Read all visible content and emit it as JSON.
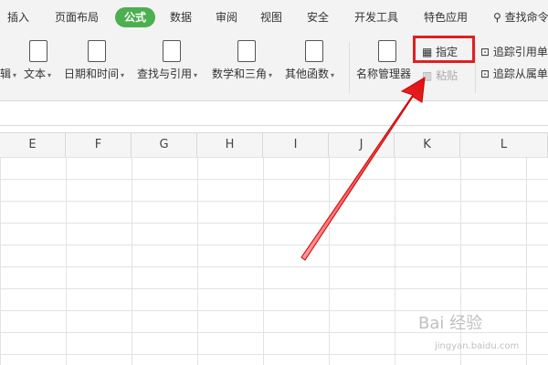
{
  "tabs": [
    {
      "label": "插入"
    },
    {
      "label": "页面布局"
    },
    {
      "label": "公式"
    },
    {
      "label": "数据"
    },
    {
      "label": "审阅"
    },
    {
      "label": "视图"
    },
    {
      "label": "安全"
    },
    {
      "label": "开发工具"
    },
    {
      "label": "特色应用"
    }
  ],
  "search": {
    "icon": "search-icon",
    "label": "查找命令"
  },
  "ribbon": {
    "groups": [
      {
        "label": "辑"
      },
      {
        "label": "文本"
      },
      {
        "label": "日期和时间"
      },
      {
        "label": "查找与引用"
      },
      {
        "label": "数学和三角"
      },
      {
        "label": "其他函数"
      }
    ],
    "name_manager": "名称管理器",
    "specify": "指定",
    "paste": "粘贴",
    "trace_precedents": "追踪引用单",
    "trace_dependents": "追踪从属单"
  },
  "columns": [
    "E",
    "F",
    "G",
    "H",
    "I",
    "J",
    "K",
    "L"
  ],
  "watermark": {
    "text": "Bai 经验",
    "sub": "jingyan.baidu.com"
  },
  "colors": {
    "accent": "#4caf50",
    "highlight": "#e02020"
  }
}
